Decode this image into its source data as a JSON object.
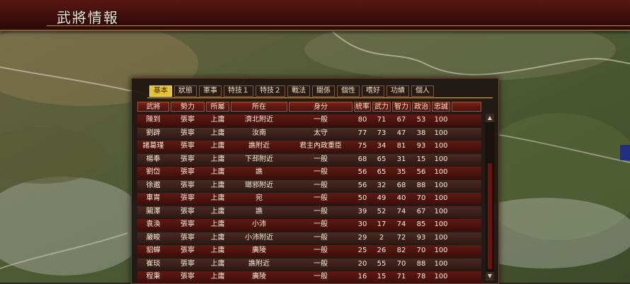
{
  "window": {
    "title": "武將情報"
  },
  "colors": {
    "title_bg": "#4a120d",
    "active_tab": "#e2c33a",
    "row_red": "#5e1a14",
    "row_dark": "#4a2a22"
  },
  "tabs": [
    {
      "label": "基本",
      "active": true
    },
    {
      "label": "狀態",
      "active": false
    },
    {
      "label": "軍事",
      "active": false
    },
    {
      "label": "特技１",
      "active": false
    },
    {
      "label": "特技２",
      "active": false
    },
    {
      "label": "戰法",
      "active": false
    },
    {
      "label": "關係",
      "active": false
    },
    {
      "label": "個性",
      "active": false
    },
    {
      "label": "嗜好",
      "active": false
    },
    {
      "label": "功績",
      "active": false
    },
    {
      "label": "個人",
      "active": false
    }
  ],
  "columns": [
    "武將",
    "勢力",
    "所屬",
    "所在",
    "身分",
    "統率",
    "武力",
    "智力",
    "政治",
    "忠誠"
  ],
  "rows": [
    [
      "陳到",
      "張寧",
      "上庸",
      "濟北附近",
      "一般",
      "80",
      "71",
      "67",
      "53",
      "100"
    ],
    [
      "劉辟",
      "張寧",
      "上庸",
      "汝南",
      "太守",
      "77",
      "73",
      "47",
      "38",
      "100"
    ],
    [
      "諸葛瑾",
      "張寧",
      "上庸",
      "譙附近",
      "君主內政重臣",
      "75",
      "34",
      "81",
      "93",
      "100"
    ],
    [
      "楊奉",
      "張寧",
      "上庸",
      "下邳附近",
      "一般",
      "68",
      "65",
      "31",
      "15",
      "100"
    ],
    [
      "劉岱",
      "張寧",
      "上庸",
      "譙",
      "一般",
      "56",
      "65",
      "35",
      "56",
      "100"
    ],
    [
      "徐邈",
      "張寧",
      "上庸",
      "瑯邪附近",
      "一般",
      "56",
      "32",
      "68",
      "88",
      "100"
    ],
    [
      "車胄",
      "張寧",
      "上庸",
      "宛",
      "一般",
      "50",
      "49",
      "40",
      "70",
      "100"
    ],
    [
      "闞澤",
      "張寧",
      "上庸",
      "譙",
      "一般",
      "39",
      "52",
      "74",
      "67",
      "100"
    ],
    [
      "袁渙",
      "張寧",
      "上庸",
      "小沛",
      "一般",
      "30",
      "17",
      "74",
      "85",
      "100"
    ],
    [
      "嚴畯",
      "張寧",
      "上庸",
      "小沛附近",
      "一般",
      "29",
      "2",
      "72",
      "93",
      "100"
    ],
    [
      "貂蟬",
      "張寧",
      "上庸",
      "廣陵",
      "一般",
      "25",
      "26",
      "82",
      "70",
      "100"
    ],
    [
      "崔琰",
      "張寧",
      "上庸",
      "譙附近",
      "一般",
      "20",
      "55",
      "70",
      "88",
      "100"
    ],
    [
      "程秉",
      "張寧",
      "上庸",
      "廣陵",
      "一般",
      "16",
      "15",
      "71",
      "78",
      "100"
    ]
  ],
  "scrollbar": {
    "up_icon": "▲",
    "down_icon": "▼"
  }
}
